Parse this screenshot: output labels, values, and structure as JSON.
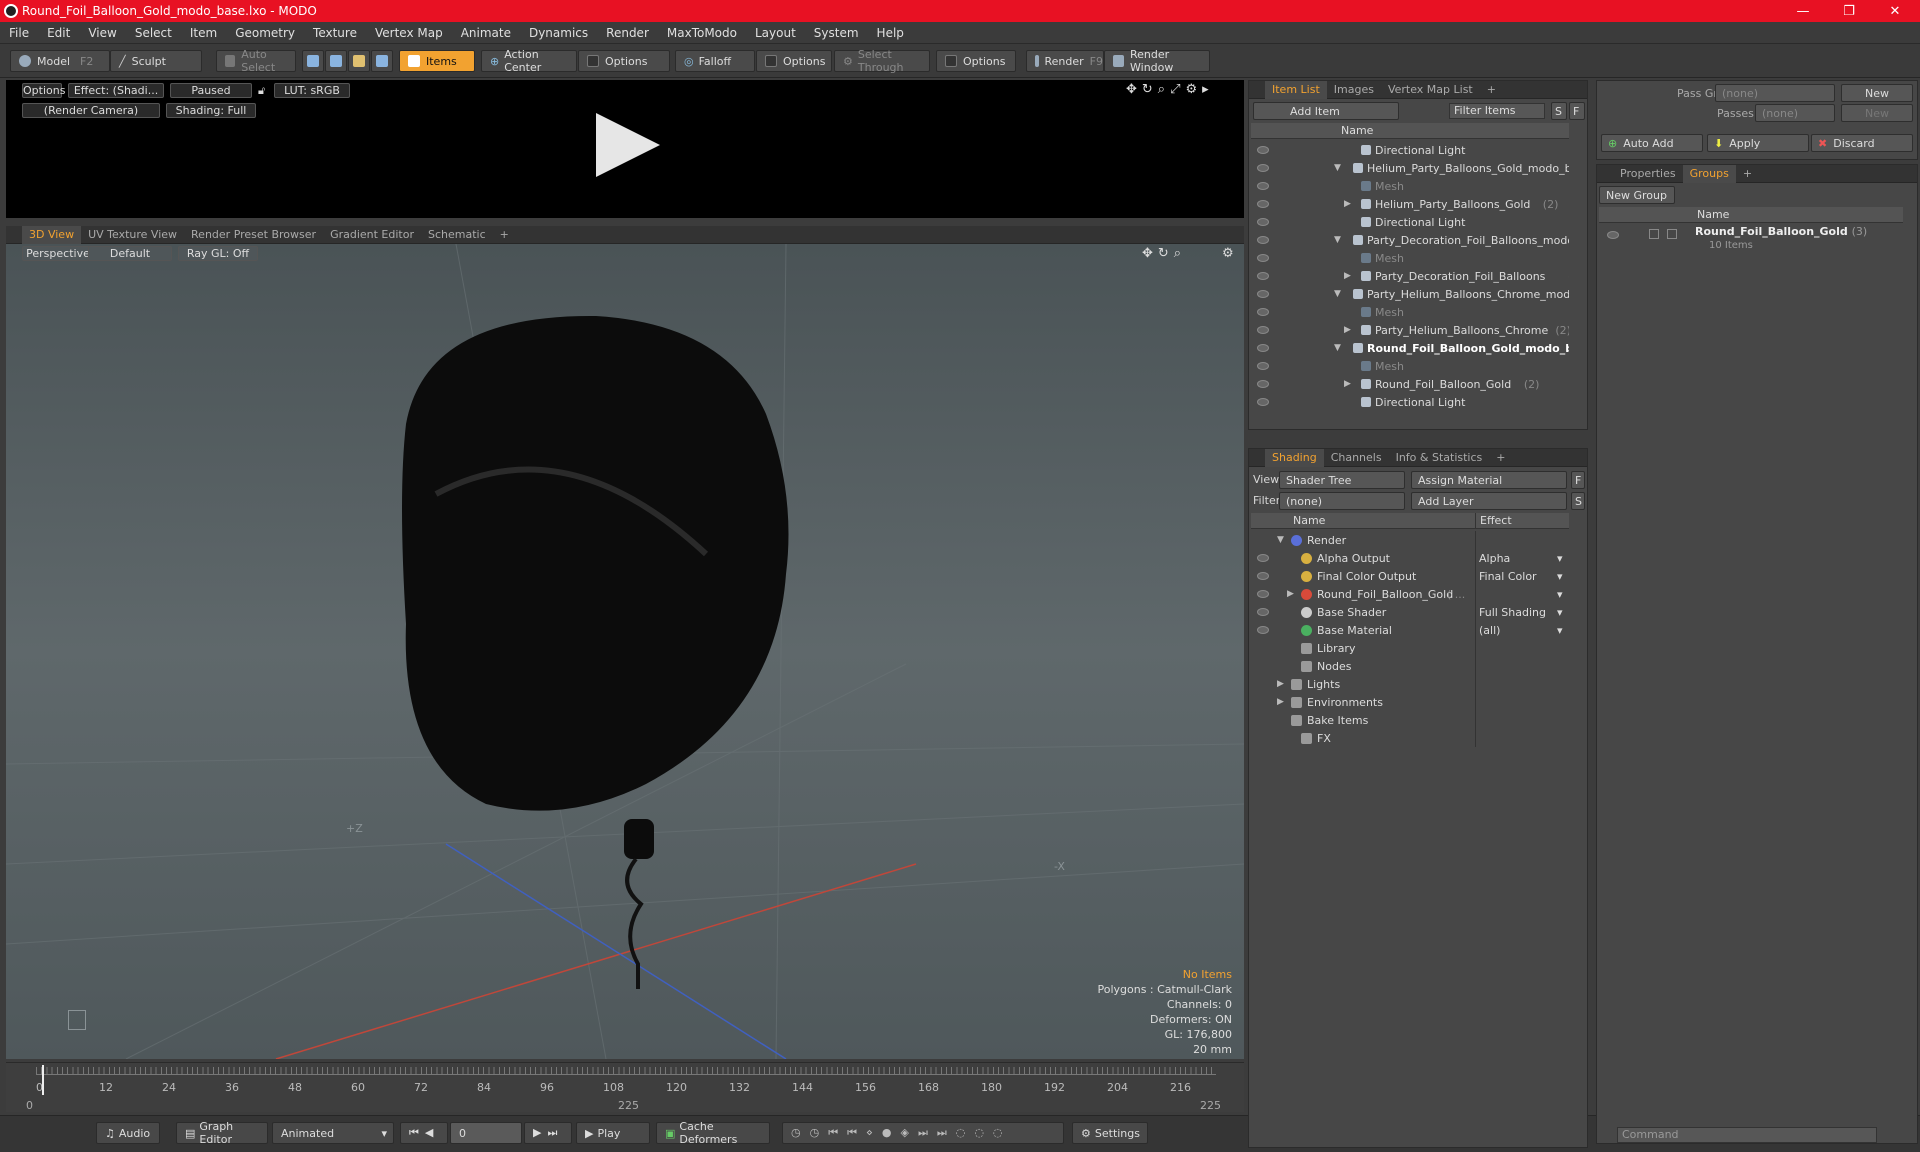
{
  "window": {
    "title": "Round_Foil_Balloon_Gold_modo_base.lxo - MODO",
    "min": "—",
    "max": "❐",
    "close": "✕"
  },
  "menu": [
    "File",
    "Edit",
    "View",
    "Select",
    "Item",
    "Geometry",
    "Texture",
    "Vertex Map",
    "Animate",
    "Dynamics",
    "Render",
    "MaxToModo",
    "Layout",
    "System",
    "Help"
  ],
  "toolbar": {
    "model": "Model",
    "model_key": "F2",
    "sculpt": "Sculpt",
    "auto_select": "Auto Select",
    "items": "Items",
    "action_center": "Action Center",
    "options1": "Options",
    "falloff": "Falloff",
    "options2": "Options",
    "select_through": "Select Through",
    "options3": "Options",
    "render": "Render",
    "render_key": "F9",
    "render_window": "Render Window"
  },
  "preview": {
    "options": "Options",
    "effect": "Effect: (Shadi...",
    "paused": "Paused",
    "lut": "LUT: sRGB",
    "camera": "(Render Camera)",
    "shading": "Shading: Full"
  },
  "view_tabs": [
    "3D View",
    "UV Texture View",
    "Render Preset Browser",
    "Gradient Editor",
    "Schematic",
    "+"
  ],
  "viewport": {
    "perspective": "Perspective",
    "default": "Default",
    "raygl": "Ray GL: Off",
    "axis_z": "+Z",
    "axis_x": "-X",
    "status": {
      "no_items": "No Items",
      "polygons": "Polygons : Catmull-Clark",
      "channels": "Channels: 0",
      "deformers": "Deformers: ON",
      "gl": "GL: 176,800",
      "scale": "20 mm"
    }
  },
  "timeline": {
    "ticks": [
      "0",
      "12",
      "24",
      "36",
      "48",
      "60",
      "72",
      "84",
      "96",
      "108",
      "120",
      "132",
      "144",
      "156",
      "168",
      "180",
      "192",
      "204",
      "216"
    ],
    "start": "0",
    "mid": "225",
    "end": "225"
  },
  "transport": {
    "audio": "Audio",
    "graph_editor": "Graph Editor",
    "animated": "Animated",
    "frame": "0",
    "play": "Play",
    "cache": "Cache Deformers",
    "settings": "Settings"
  },
  "item_list": {
    "tabs": [
      "Item List",
      "Images",
      "Vertex Map List",
      "+"
    ],
    "add_item": "Add Item",
    "filter": "Filter Items",
    "s": "S",
    "f": "F",
    "col_name": "Name",
    "rows": [
      {
        "label": "Directional Light",
        "indent": 3,
        "dim": false,
        "bold": false,
        "arrow": ""
      },
      {
        "label": "Helium_Party_Balloons_Gold_modo_bas ...",
        "indent": 1,
        "dim": false,
        "bold": false,
        "arrow": "▼"
      },
      {
        "label": "Mesh",
        "indent": 3,
        "dim": true,
        "bold": false,
        "arrow": ""
      },
      {
        "label": "Helium_Party_Balloons_Gold",
        "suffix": "(2)",
        "indent": 3,
        "dim": false,
        "bold": false,
        "arrow": "▶"
      },
      {
        "label": "Directional Light",
        "indent": 3,
        "dim": false,
        "bold": false,
        "arrow": ""
      },
      {
        "label": "Party_Decoration_Foil_Balloons_modo_b...",
        "indent": 1,
        "dim": false,
        "bold": false,
        "arrow": "▼"
      },
      {
        "label": "Mesh",
        "indent": 3,
        "dim": true,
        "bold": false,
        "arrow": ""
      },
      {
        "label": "Party_Decoration_Foil_Balloons",
        "suffix": "(2)",
        "indent": 3,
        "dim": false,
        "bold": false,
        "arrow": "▶"
      },
      {
        "label": "Party_Helium_Balloons_Chrome_modo_b...",
        "indent": 1,
        "dim": false,
        "bold": false,
        "arrow": "▼"
      },
      {
        "label": "Mesh",
        "indent": 3,
        "dim": true,
        "bold": false,
        "arrow": ""
      },
      {
        "label": "Party_Helium_Balloons_Chrome",
        "suffix": "(2)",
        "indent": 3,
        "dim": false,
        "bold": false,
        "arrow": "▶"
      },
      {
        "label": "Round_Foil_Balloon_Gold_modo_b...",
        "indent": 1,
        "dim": false,
        "bold": true,
        "arrow": "▼"
      },
      {
        "label": "Mesh",
        "indent": 3,
        "dim": true,
        "bold": false,
        "arrow": ""
      },
      {
        "label": "Round_Foil_Balloon_Gold",
        "suffix": "(2)",
        "indent": 3,
        "dim": false,
        "bold": false,
        "arrow": "▶"
      },
      {
        "label": "Directional Light",
        "indent": 3,
        "dim": false,
        "bold": false,
        "arrow": ""
      }
    ]
  },
  "shading": {
    "tabs": [
      "Shading",
      "Channels",
      "Info & Statistics",
      "+"
    ],
    "view_label": "View",
    "view_value": "Shader Tree",
    "assign": "Assign Material",
    "filter_label": "Filter",
    "filter_value": "(none)",
    "add_layer": "Add Layer",
    "f": "F",
    "s": "S",
    "col_name": "Name",
    "col_effect": "Effect",
    "rows": [
      {
        "label": "Render",
        "effect": "",
        "indent": 0,
        "arrow": "▼",
        "color": "#5a6fd8",
        "eye": false
      },
      {
        "label": "Alpha Output",
        "effect": "Alpha",
        "indent": 1,
        "arrow": "",
        "color": "#d8b040",
        "eye": true
      },
      {
        "label": "Final Color Output",
        "effect": "Final Color",
        "indent": 1,
        "arrow": "",
        "color": "#d8b040",
        "eye": true
      },
      {
        "label": "Round_Foil_Balloon_Gold",
        "suffix": "( ...",
        "effect": "",
        "indent": 1,
        "arrow": "▶",
        "color": "#d84a3a",
        "eye": true
      },
      {
        "label": "Base Shader",
        "effect": "Full Shading",
        "indent": 1,
        "arrow": "",
        "color": "#cccccc",
        "eye": true
      },
      {
        "label": "Base Material",
        "effect": "(all)",
        "indent": 1,
        "arrow": "",
        "color": "#4ab060",
        "eye": true
      },
      {
        "label": "Library",
        "effect": "",
        "indent": 1,
        "arrow": "",
        "color": "",
        "eye": false
      },
      {
        "label": "Nodes",
        "effect": "",
        "indent": 1,
        "arrow": "",
        "color": "",
        "eye": false
      },
      {
        "label": "Lights",
        "effect": "",
        "indent": 0,
        "arrow": "▶",
        "color": "",
        "eye": false
      },
      {
        "label": "Environments",
        "effect": "",
        "indent": 0,
        "arrow": "▶",
        "color": "",
        "eye": false
      },
      {
        "label": "Bake Items",
        "effect": "",
        "indent": 0,
        "arrow": "",
        "color": "",
        "eye": false
      },
      {
        "label": "FX",
        "effect": "",
        "indent": 1,
        "arrow": "",
        "color": "",
        "eye": false
      }
    ]
  },
  "pass": {
    "pass_groups": "Pass Groups",
    "passes": "Passes",
    "none1": "(none)",
    "none2": "(none)",
    "new1": "New",
    "new2": "New",
    "auto_add": "Auto Add",
    "apply": "Apply",
    "discard": "Discard"
  },
  "groups": {
    "tabs": [
      "Properties",
      "Groups",
      "+"
    ],
    "new_group": "New Group",
    "col_name": "Name",
    "item": "Round_Foil_Balloon_Gold",
    "item_suffix": "(3)",
    "sub": "10 Items"
  },
  "command": {
    "placeholder": "Command"
  }
}
